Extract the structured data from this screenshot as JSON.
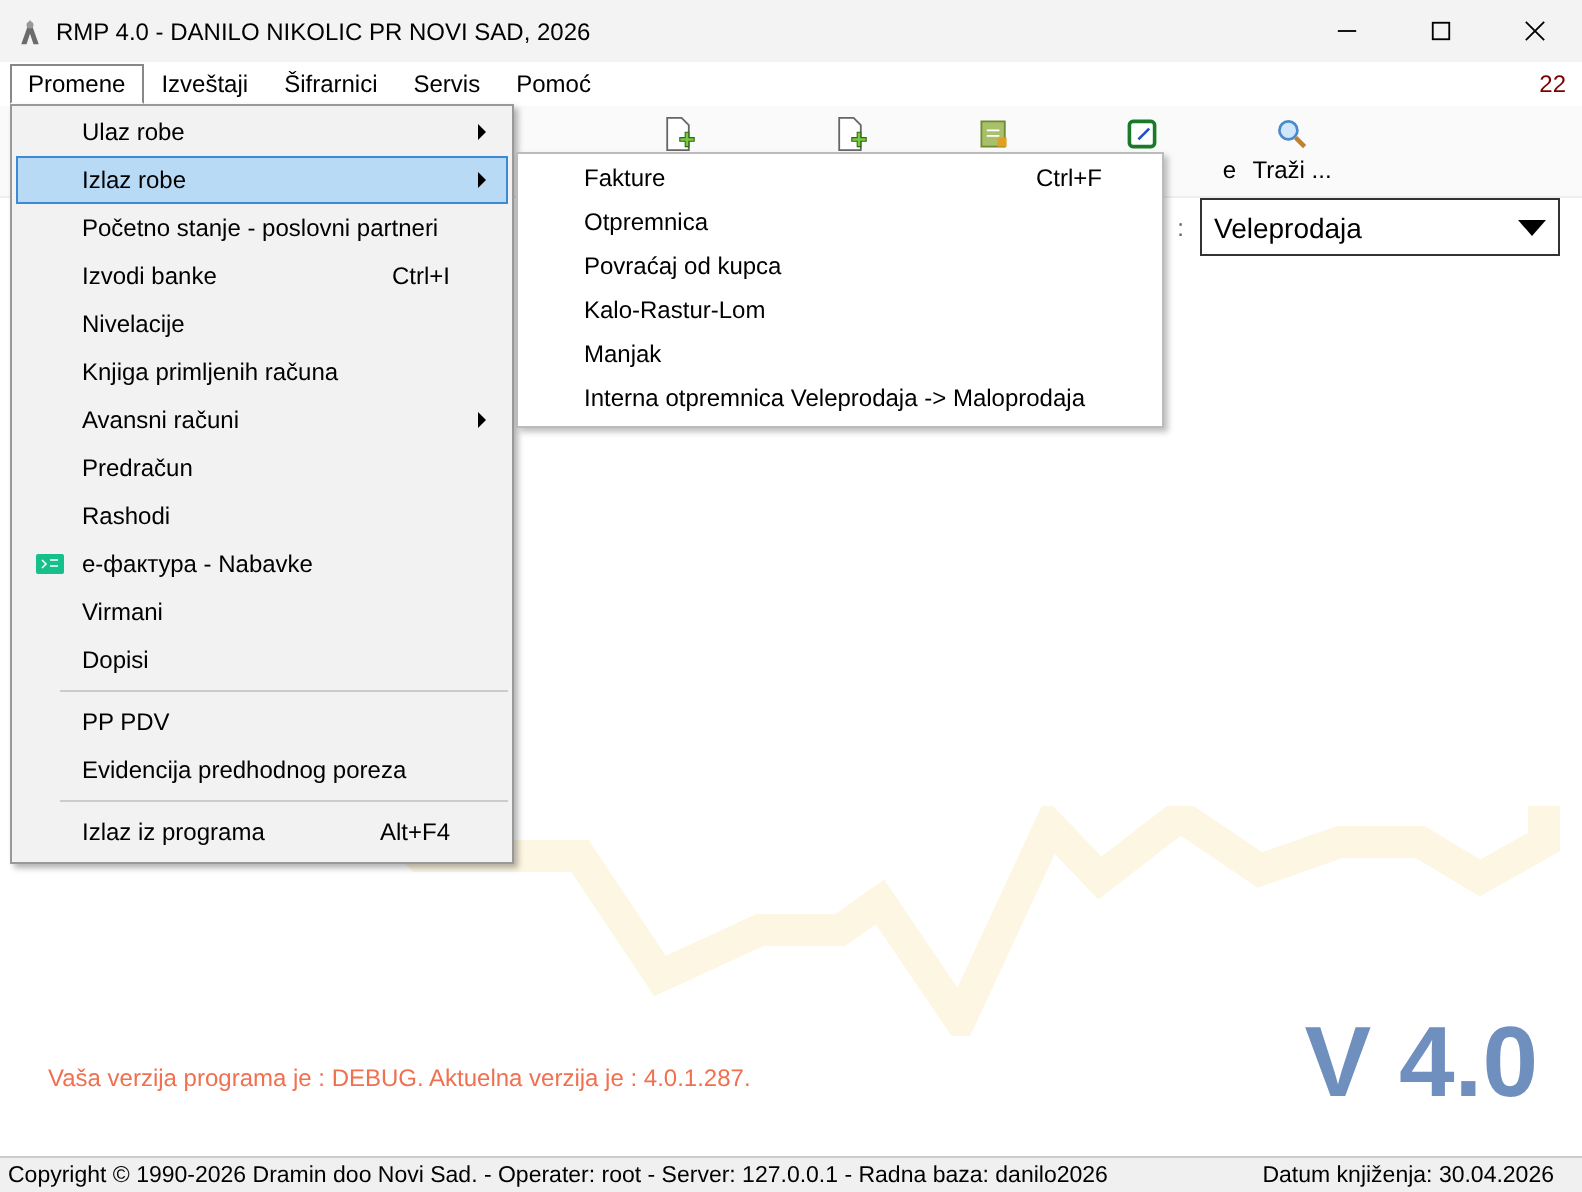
{
  "window": {
    "title": "RMP 4.0 - DANILO NIKOLIC PR NOVI SAD, 2026"
  },
  "menubar": {
    "items": [
      {
        "label": "Promene",
        "selected": true
      },
      {
        "label": "Izveštaji",
        "selected": false
      },
      {
        "label": "Šifrarnici",
        "selected": false
      },
      {
        "label": "Servis",
        "selected": false
      },
      {
        "label": "Pomoć",
        "selected": false
      }
    ],
    "counter": "22"
  },
  "toolbar": {
    "partial_label": "e",
    "search_label": "Traži ..."
  },
  "filter": {
    "colon": ":",
    "value": "Veleprodaja"
  },
  "menu": {
    "items": [
      {
        "kind": "item",
        "label": "Ulaz robe",
        "submenu": true,
        "selected": false
      },
      {
        "kind": "item",
        "label": "Izlaz robe",
        "submenu": true,
        "selected": true
      },
      {
        "kind": "item",
        "label": "Početno stanje - poslovni partneri",
        "submenu": false,
        "selected": false
      },
      {
        "kind": "item",
        "label": "Izvodi banke",
        "shortcut": "Ctrl+I",
        "submenu": false,
        "selected": false
      },
      {
        "kind": "item",
        "label": "Nivelacije",
        "submenu": false,
        "selected": false
      },
      {
        "kind": "item",
        "label": "Knjiga primljenih računa",
        "submenu": false,
        "selected": false
      },
      {
        "kind": "item",
        "label": "Avansni računi",
        "submenu": true,
        "selected": false
      },
      {
        "kind": "item",
        "label": "Predračun",
        "submenu": false,
        "selected": false
      },
      {
        "kind": "item",
        "label": "Rashodi",
        "submenu": false,
        "selected": false
      },
      {
        "kind": "item",
        "label": "е-фактура - Nabavke",
        "submenu": false,
        "selected": false,
        "icon": true
      },
      {
        "kind": "item",
        "label": "Virmani",
        "submenu": false,
        "selected": false
      },
      {
        "kind": "item",
        "label": "Dopisi",
        "submenu": false,
        "selected": false
      },
      {
        "kind": "separator"
      },
      {
        "kind": "item",
        "label": "PP PDV",
        "submenu": false,
        "selected": false
      },
      {
        "kind": "item",
        "label": "Evidencija predhodnog poreza",
        "submenu": false,
        "selected": false
      },
      {
        "kind": "separator"
      },
      {
        "kind": "item",
        "label": "Izlaz iz programa",
        "shortcut": "Alt+F4",
        "submenu": false,
        "selected": false
      }
    ]
  },
  "submenu": {
    "items": [
      {
        "label": "Fakture",
        "shortcut": "Ctrl+F"
      },
      {
        "label": "Otpremnica"
      },
      {
        "label": "Povraćaj od kupca"
      },
      {
        "label": "Kalo-Rastur-Lom"
      },
      {
        "label": "Manjak"
      },
      {
        "label": "Interna otpremnica Veleprodaja -> Maloprodaja"
      }
    ]
  },
  "version_notice": "Vaša verzija programa je : DEBUG. Aktuelna verzija je : 4.0.1.287.",
  "version_badge": "V 4.0",
  "status_bar": {
    "left": "Copyright © 1990-2026 Dramin doo Novi Sad. - Operater: root - Server: 127.0.0.1 - Radna baza: danilo2026",
    "right": "Datum knjiženja: 30.04.2026"
  }
}
